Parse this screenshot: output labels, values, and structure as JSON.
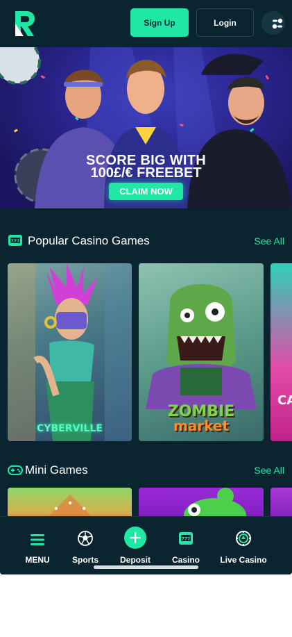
{
  "header": {
    "signup_label": "Sign Up",
    "login_label": "Login"
  },
  "banner": {
    "line1": "SCORE BIG WITH",
    "line2": "100£/€ FREEBET",
    "cta_label": "CLAIM NOW"
  },
  "popular": {
    "title": "Popular Casino Games",
    "see_all": "See All",
    "games": [
      {
        "name": "CYBERVILLE"
      },
      {
        "name": "ZOMBIE",
        "name2": "market"
      },
      {
        "name": "CA"
      }
    ]
  },
  "mini": {
    "title": "Mini Games",
    "see_all": "See All"
  },
  "nav": {
    "items": [
      {
        "label": "MENU",
        "icon": "menu-icon"
      },
      {
        "label": "Sports",
        "icon": "soccer-ball-icon"
      },
      {
        "label": "Deposit",
        "icon": "plus-icon"
      },
      {
        "label": "Casino",
        "icon": "slot-machine-icon"
      },
      {
        "label": "Live Casino",
        "icon": "poker-chip-icon"
      }
    ]
  },
  "colors": {
    "accent": "#1ee8a4",
    "background": "#0b2530"
  }
}
